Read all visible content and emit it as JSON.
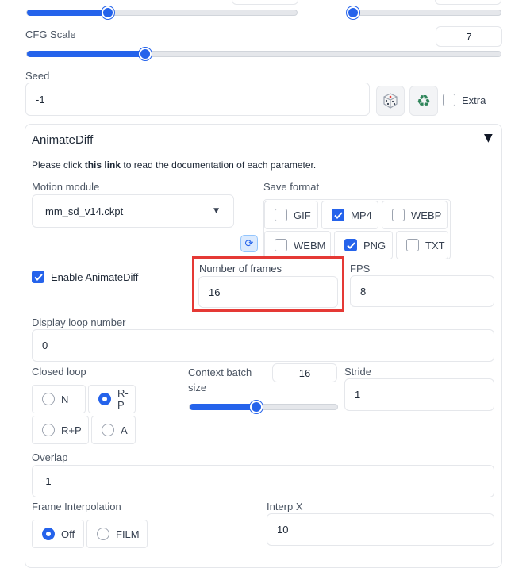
{
  "cfg": {
    "label": "CFG Scale",
    "value": "7",
    "level": 0.25
  },
  "top_sliders": {
    "left_level": 0.3,
    "right_level": 0.0
  },
  "seed": {
    "label": "Seed",
    "value": "-1",
    "extra_label": "Extra",
    "dice_icon": "dice-icon",
    "recycle_icon": "recycle-icon"
  },
  "animatediff": {
    "title": "AnimateDiff",
    "collapse_icon": "triangle-down-icon",
    "doc_prefix": "Please click ",
    "doc_link": "this link",
    "doc_suffix": " to read the documentation of each parameter.",
    "motion_module": {
      "label": "Motion module",
      "value": "mm_sd_v14.ckpt"
    },
    "refresh_icon": "refresh-icon",
    "save_format": {
      "label": "Save format",
      "options": [
        {
          "label": "GIF",
          "checked": false
        },
        {
          "label": "MP4",
          "checked": true
        },
        {
          "label": "WEBP",
          "checked": false
        },
        {
          "label": "WEBM",
          "checked": false
        },
        {
          "label": "PNG",
          "checked": true
        },
        {
          "label": "TXT",
          "checked": false
        }
      ]
    },
    "enable": {
      "label": "Enable AnimateDiff",
      "checked": true
    },
    "frames": {
      "label": "Number of frames",
      "value": "16"
    },
    "fps": {
      "label": "FPS",
      "value": "8"
    },
    "display_loop": {
      "label": "Display loop number",
      "value": "0"
    },
    "closed_loop": {
      "label": "Closed loop",
      "options": [
        "N",
        "R-P",
        "R+P",
        "A"
      ],
      "selected": "R-P"
    },
    "context_batch": {
      "label": "Context batch size",
      "value": "16",
      "level": 0.45
    },
    "stride": {
      "label": "Stride",
      "value": "1"
    },
    "overlap": {
      "label": "Overlap",
      "value": "-1"
    },
    "frame_interp": {
      "label": "Frame Interpolation",
      "options": [
        "Off",
        "FILM"
      ],
      "selected": "Off"
    },
    "interp_x": {
      "label": "Interp X",
      "value": "10"
    }
  },
  "colors": {
    "accent": "#2563eb",
    "highlight": "#e53935"
  }
}
